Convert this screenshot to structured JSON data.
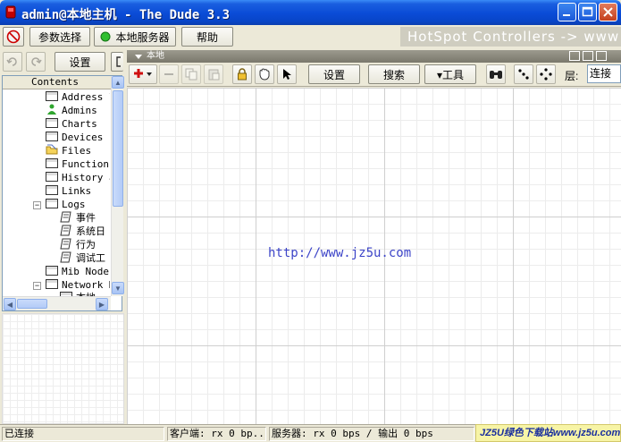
{
  "window": {
    "title": "admin@本地主机 - The Dude 3.3",
    "brand_color": "#0a4bd6"
  },
  "toolbar": {
    "prefs_label": "参数选择",
    "server_label": "本地服务器",
    "help_label": "帮助",
    "settings_label": "设置",
    "hotspot_text": "HotSpot Controllers -> www"
  },
  "tree": {
    "header": "Contents",
    "items": [
      {
        "label": "Address l",
        "icon": "table-icon"
      },
      {
        "label": "Admins",
        "icon": "user-icon"
      },
      {
        "label": "Charts",
        "icon": "table-icon"
      },
      {
        "label": "Devices",
        "icon": "table-icon"
      },
      {
        "label": "Files",
        "icon": "folder-icon"
      },
      {
        "label": "Functions",
        "icon": "table-icon"
      },
      {
        "label": "History a",
        "icon": "table-icon"
      },
      {
        "label": "Links",
        "icon": "table-icon"
      },
      {
        "label": "Logs",
        "icon": "table-icon"
      },
      {
        "label": "事件",
        "icon": "log-icon"
      },
      {
        "label": "系统日",
        "icon": "log-icon"
      },
      {
        "label": "行为",
        "icon": "log-icon"
      },
      {
        "label": "调试工",
        "icon": "log-icon"
      },
      {
        "label": "Mib Nodes",
        "icon": "table-icon"
      },
      {
        "label": "Network M",
        "icon": "table-icon"
      },
      {
        "label": "本地",
        "icon": "table-icon"
      }
    ]
  },
  "map": {
    "tab_title": "本地",
    "settings_label": "设置",
    "search_label": "搜索",
    "tools_label": "▾工具",
    "layer_label": "层:",
    "layer_value": "连接",
    "center_text": "http://www.jz5u.com"
  },
  "status": {
    "connection": "已连接",
    "client": "客户端: rx 0 bp...",
    "server": "服务器: rx 0 bps / 输出 0 bps",
    "site_badge": "JZ5U绿色下载站www.jz5u.com"
  }
}
